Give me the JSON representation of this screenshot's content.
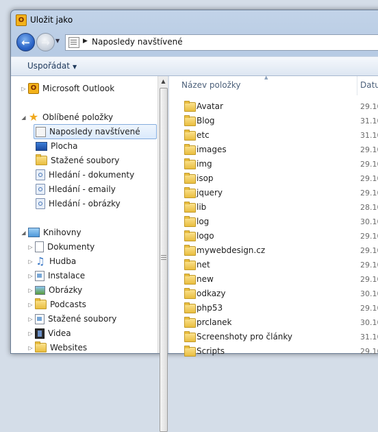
{
  "window": {
    "title": "Uložit jako",
    "app_icon": "O"
  },
  "address": {
    "path": "Naposledy navštívené"
  },
  "toolbar": {
    "organize_label": "Uspořádat"
  },
  "nav": {
    "outlook": "Microsoft Outlook",
    "favorites": {
      "label": "Oblíbené položky",
      "items": [
        "Naposledy navštívené",
        "Plocha",
        "Stažené soubory",
        "Hledání - dokumenty",
        "Hledání - emaily",
        "Hledání - obrázky"
      ]
    },
    "libraries": {
      "label": "Knihovny",
      "items": [
        "Dokumenty",
        "Hudba",
        "Instalace",
        "Obrázky",
        "Podcasts",
        "Stažené soubory",
        "Videa",
        "Websites"
      ]
    }
  },
  "columns": {
    "name": "Název položky",
    "date": "Datu"
  },
  "files": [
    {
      "name": "Avatar",
      "date": "29.10"
    },
    {
      "name": "Blog",
      "date": "31.10"
    },
    {
      "name": "etc",
      "date": "31.10"
    },
    {
      "name": "images",
      "date": "29.10"
    },
    {
      "name": "img",
      "date": "29.10"
    },
    {
      "name": "isop",
      "date": "29.10"
    },
    {
      "name": "jquery",
      "date": "29.10"
    },
    {
      "name": "lib",
      "date": "28.10"
    },
    {
      "name": "log",
      "date": "30.10"
    },
    {
      "name": "logo",
      "date": "29.10"
    },
    {
      "name": "mywebdesign.cz",
      "date": "29.10"
    },
    {
      "name": "net",
      "date": "29.10"
    },
    {
      "name": "new",
      "date": "29.10"
    },
    {
      "name": "odkazy",
      "date": "30.10"
    },
    {
      "name": "php53",
      "date": "29.10"
    },
    {
      "name": "prclanek",
      "date": "30.10"
    },
    {
      "name": "Screenshoty pro články",
      "date": "31.10"
    },
    {
      "name": "Scripts",
      "date": "29.10"
    }
  ],
  "colors": {
    "accent": "#1e395b",
    "selection": "#dbeafc",
    "folder": "#e9bd3f"
  }
}
